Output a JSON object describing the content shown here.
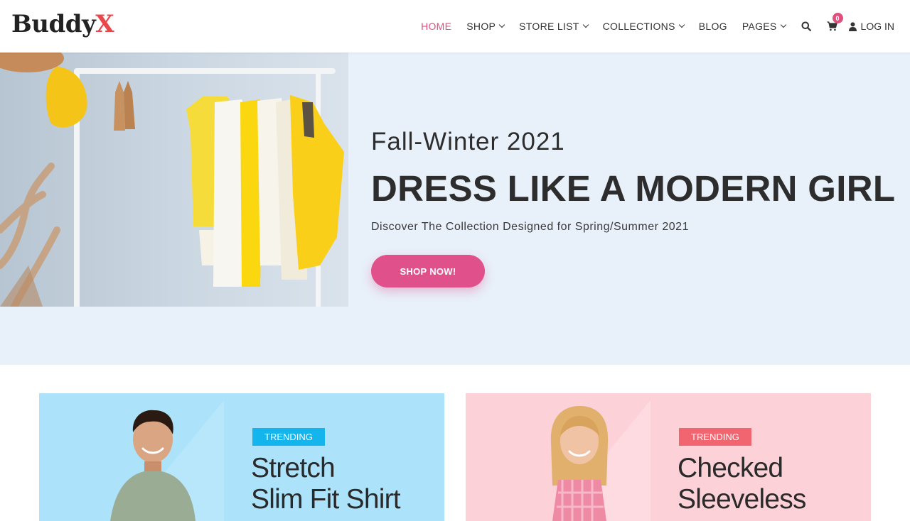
{
  "brand": {
    "name_main": "Buddy",
    "name_accent": "X"
  },
  "nav": {
    "items": [
      {
        "label": "HOME",
        "active": true,
        "dropdown": false
      },
      {
        "label": "SHOP",
        "active": false,
        "dropdown": true
      },
      {
        "label": "STORE LIST",
        "active": false,
        "dropdown": true
      },
      {
        "label": "COLLECTIONS",
        "active": false,
        "dropdown": true
      },
      {
        "label": "BLOG",
        "active": false,
        "dropdown": false
      },
      {
        "label": "PAGES",
        "active": false,
        "dropdown": true
      }
    ],
    "search_icon": "search-icon",
    "cart_icon": "cart-icon",
    "cart_count": "0",
    "login_label": "LOG IN"
  },
  "hero": {
    "subtitle": "Fall-Winter 2021",
    "title": "DRESS LIKE A MODERN GIRL",
    "description": "Discover The Collection Designed for Spring/Summer 2021",
    "button_label": "SHOP NOW!"
  },
  "promos": [
    {
      "tag": "TRENDING",
      "title_line1": "Stretch",
      "title_line2": "Slim Fit Shirt"
    },
    {
      "tag": "TRENDING",
      "title_line1": "Checked",
      "title_line2": "Sleeveless"
    }
  ],
  "colors": {
    "accent": "#e0507e",
    "hero_bg": "#e8f0fa",
    "promo_blue": "#ace3fb",
    "promo_pink": "#fdd1d8",
    "tag_blue": "#14b4ec",
    "tag_pink": "#f06570"
  }
}
